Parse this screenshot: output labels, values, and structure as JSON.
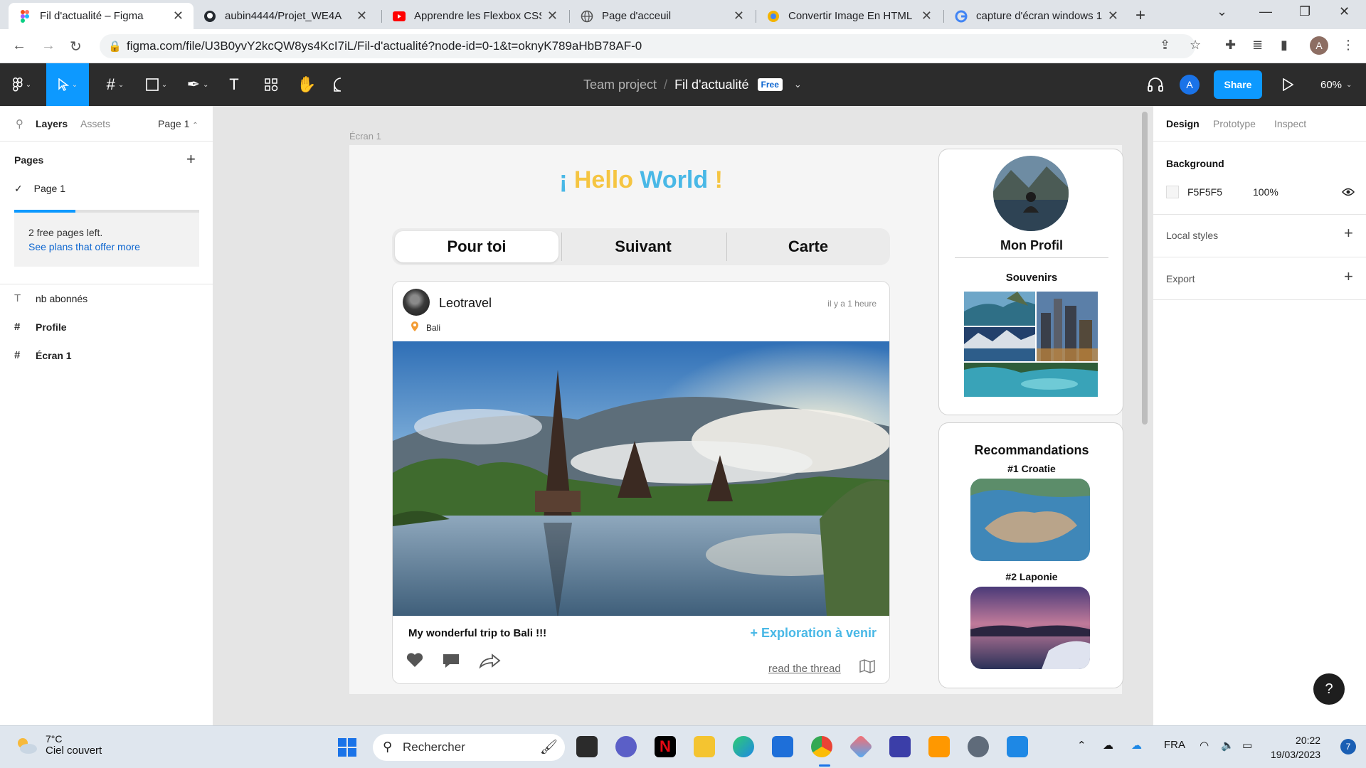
{
  "browser": {
    "tabs": [
      {
        "title": "Fil d'actualité – Figma",
        "active": true
      },
      {
        "title": "aubin4444/Projet_WE4A"
      },
      {
        "title": "Apprendre les Flexbox CSS"
      },
      {
        "title": "Page d'acceuil"
      },
      {
        "title": "Convertir Image En HTML E"
      },
      {
        "title": "capture d'écran windows 1"
      }
    ],
    "url": "figma.com/file/U3B0yvY2kcQW8ys4KcI7iL/Fil-d'actualité?node-id=0-1&t=oknyK789aHbB78AF-0",
    "profile_initial": "A"
  },
  "figma_toolbar": {
    "project": "Team project",
    "file_name": "Fil d'actualité",
    "plan_badge": "Free",
    "user_initial": "A",
    "share_label": "Share",
    "zoom": "60%"
  },
  "left_panel": {
    "tab_layers": "Layers",
    "tab_assets": "Assets",
    "page_selector": "Page 1",
    "pages_heading": "Pages",
    "pages": [
      "Page 1"
    ],
    "free_pages_text": "2 free pages left.",
    "plans_link": "See plans that offer more",
    "layers": [
      {
        "name": "nb abonnés",
        "type": "text"
      },
      {
        "name": "Profile",
        "type": "frame"
      },
      {
        "name": "Écran 1",
        "type": "frame"
      }
    ]
  },
  "canvas": {
    "frame_label": "Écran 1",
    "hello_left": "¡ ",
    "hello_word1": "Hello",
    "hello_word2": " World",
    "hello_right": " !",
    "tabs": [
      "Pour toi",
      "Suivant",
      "Carte"
    ],
    "post": {
      "username": "Leotravel",
      "time": "il y a 1 heure",
      "location": "Bali",
      "caption": "My wonderful trip to Bali !!!",
      "explore_link": "+ Exploration à venir",
      "thread_link": "read the thread"
    },
    "profile": {
      "title": "Mon Profil",
      "souvenirs": "Souvenirs"
    },
    "recommendations": {
      "title": "Recommandations",
      "items": [
        "#1 Croatie",
        "#2 Laponie"
      ]
    }
  },
  "right_panel": {
    "tabs": [
      "Design",
      "Prototype",
      "Inspect"
    ],
    "background_label": "Background",
    "background_hex": "F5F5F5",
    "background_opacity": "100%",
    "local_styles": "Local styles",
    "export": "Export"
  },
  "taskbar": {
    "temperature": "7°C",
    "weather": "Ciel couvert",
    "search_placeholder": "Rechercher",
    "language": "FRA",
    "time": "20:22",
    "date": "19/03/2023",
    "notifications": "7"
  },
  "colors": {
    "figma_blue": "#0d99ff",
    "hello_yellow": "#f5c542",
    "hello_blue": "#49b8e6",
    "toolbar_dark": "#2c2c2c"
  }
}
